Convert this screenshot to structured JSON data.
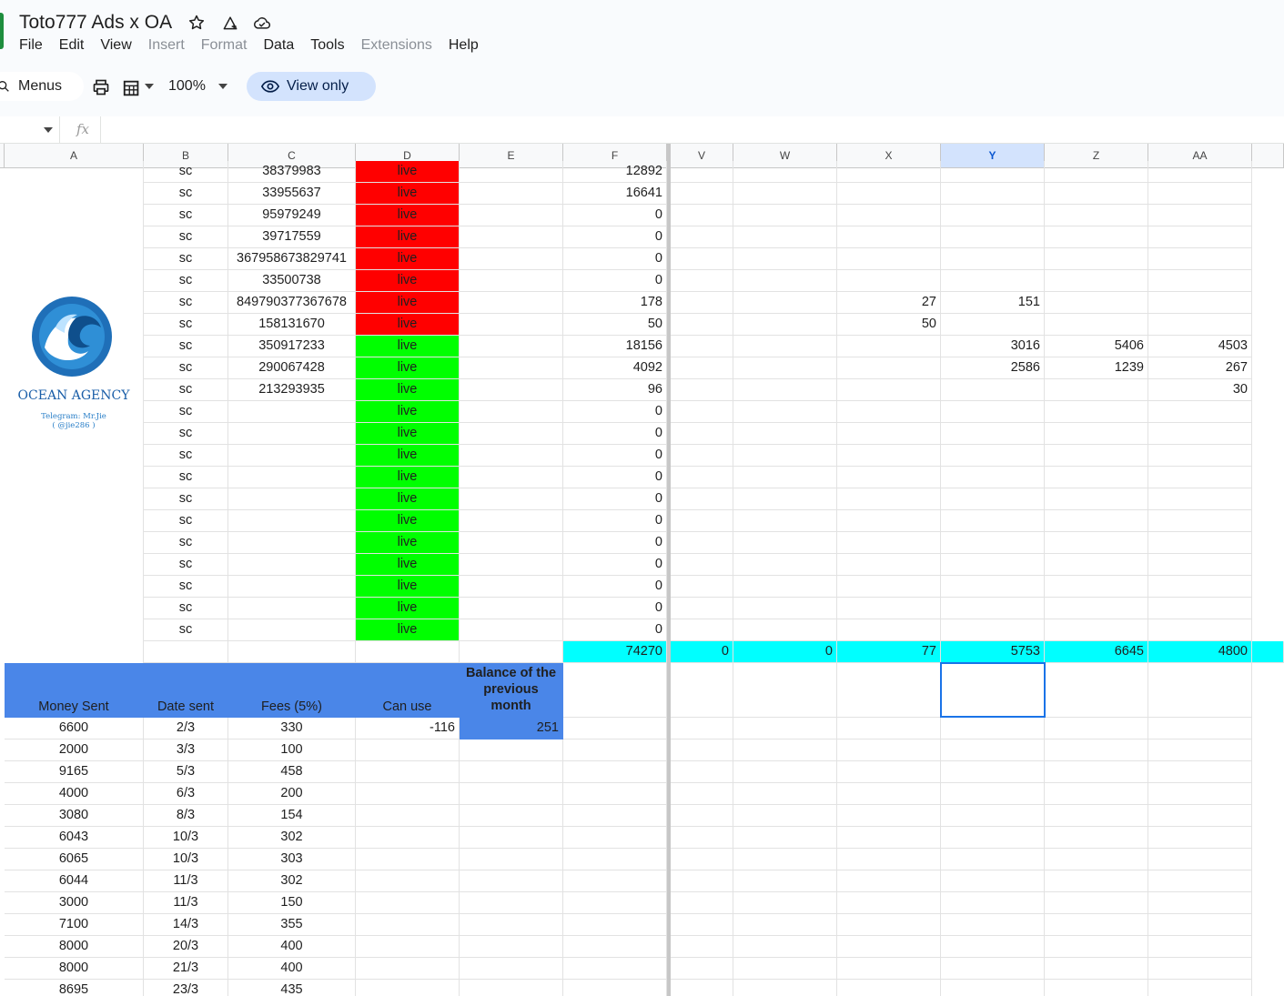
{
  "app": {
    "title": "Toto777 Ads x OA",
    "menu": [
      {
        "label": "File",
        "dim": false
      },
      {
        "label": "Edit",
        "dim": false
      },
      {
        "label": "View",
        "dim": false
      },
      {
        "label": "Insert",
        "dim": true
      },
      {
        "label": "Format",
        "dim": true
      },
      {
        "label": "Data",
        "dim": false
      },
      {
        "label": "Tools",
        "dim": false
      },
      {
        "label": "Extensions",
        "dim": true
      },
      {
        "label": "Help",
        "dim": false
      }
    ],
    "toolbar": {
      "menus_label": "Menus",
      "zoom": "100%",
      "view_only": "View only"
    },
    "formula_bar": {
      "fx": "fx",
      "value": ""
    }
  },
  "colors": {
    "red": "#ff0000",
    "green": "#00ff00",
    "cyan": "#00ffff",
    "blue": "#4a86e8"
  },
  "logo": {
    "name": "OCEAN AGENCY",
    "telegram": "Telegram: Mr.Jie",
    "handle": "( @jie286 )"
  },
  "columns": [
    "A",
    "B",
    "C",
    "D",
    "E",
    "F",
    "V",
    "W",
    "X",
    "Y",
    "Z",
    "AA"
  ],
  "selected_column": "Y",
  "rows": [
    {
      "b": "sc",
      "c": "38379983",
      "d": "live",
      "status": "red",
      "note": false,
      "f": "12892",
      "v": "",
      "w": "",
      "x": "",
      "y": "",
      "z": "",
      "aa": ""
    },
    {
      "b": "sc",
      "c": "33955637",
      "d": "live",
      "status": "red",
      "note": true,
      "f": "16641",
      "v": "",
      "w": "",
      "x": "",
      "y": "",
      "z": "",
      "aa": ""
    },
    {
      "b": "sc",
      "c": "95979249",
      "d": "live",
      "status": "red",
      "note": false,
      "f": "0",
      "v": "",
      "w": "",
      "x": "",
      "y": "",
      "z": "",
      "aa": ""
    },
    {
      "b": "sc",
      "c": "39717559",
      "d": "live",
      "status": "red",
      "note": false,
      "f": "0",
      "v": "",
      "w": "",
      "x": "",
      "y": "",
      "z": "",
      "aa": ""
    },
    {
      "b": "sc",
      "c": "367958673829741",
      "d": "live",
      "status": "red",
      "note": false,
      "f": "0",
      "v": "",
      "w": "",
      "x": "",
      "y": "",
      "z": "",
      "aa": ""
    },
    {
      "b": "sc",
      "c": "33500738",
      "d": "live",
      "status": "red",
      "note": false,
      "f": "0",
      "v": "",
      "w": "",
      "x": "",
      "y": "",
      "z": "",
      "aa": ""
    },
    {
      "b": "sc",
      "c": "849790377367678",
      "d": "live",
      "status": "red",
      "note": false,
      "f": "178",
      "v": "",
      "w": "",
      "x": "27",
      "y": "151",
      "z": "",
      "aa": ""
    },
    {
      "b": "sc",
      "c": "158131670",
      "d": "live",
      "status": "red",
      "note": true,
      "f": "50",
      "v": "",
      "w": "",
      "x": "50",
      "y": "",
      "z": "",
      "aa": ""
    },
    {
      "b": "sc",
      "c": "350917233",
      "d": "live",
      "status": "green",
      "note": false,
      "f": "18156",
      "v": "",
      "w": "",
      "x": "",
      "y": "3016",
      "z": "5406",
      "aa": "4503"
    },
    {
      "b": "sc",
      "c": "290067428",
      "d": "live",
      "status": "green",
      "note": false,
      "f": "4092",
      "v": "",
      "w": "",
      "x": "",
      "y": "2586",
      "z": "1239",
      "aa": "267"
    },
    {
      "b": "sc",
      "c": "213293935",
      "d": "live",
      "status": "green",
      "note": false,
      "f": "96",
      "v": "",
      "w": "",
      "x": "",
      "y": "",
      "z": "",
      "aa": "30"
    },
    {
      "b": "sc",
      "c": "",
      "d": "live",
      "status": "green",
      "note": false,
      "f": "0",
      "v": "",
      "w": "",
      "x": "",
      "y": "",
      "z": "",
      "aa": ""
    },
    {
      "b": "sc",
      "c": "",
      "d": "live",
      "status": "green",
      "note": false,
      "f": "0",
      "v": "",
      "w": "",
      "x": "",
      "y": "",
      "z": "",
      "aa": ""
    },
    {
      "b": "sc",
      "c": "",
      "d": "live",
      "status": "green",
      "note": false,
      "f": "0",
      "v": "",
      "w": "",
      "x": "",
      "y": "",
      "z": "",
      "aa": ""
    },
    {
      "b": "sc",
      "c": "",
      "d": "live",
      "status": "green",
      "note": false,
      "f": "0",
      "v": "",
      "w": "",
      "x": "",
      "y": "",
      "z": "",
      "aa": ""
    },
    {
      "b": "sc",
      "c": "",
      "d": "live",
      "status": "green",
      "note": false,
      "f": "0",
      "v": "",
      "w": "",
      "x": "",
      "y": "",
      "z": "",
      "aa": ""
    },
    {
      "b": "sc",
      "c": "",
      "d": "live",
      "status": "green",
      "note": false,
      "f": "0",
      "v": "",
      "w": "",
      "x": "",
      "y": "",
      "z": "",
      "aa": ""
    },
    {
      "b": "sc",
      "c": "",
      "d": "live",
      "status": "green",
      "note": false,
      "f": "0",
      "v": "",
      "w": "",
      "x": "",
      "y": "",
      "z": "",
      "aa": ""
    },
    {
      "b": "sc",
      "c": "",
      "d": "live",
      "status": "green",
      "note": false,
      "f": "0",
      "v": "",
      "w": "",
      "x": "",
      "y": "",
      "z": "",
      "aa": ""
    },
    {
      "b": "sc",
      "c": "",
      "d": "live",
      "status": "green",
      "note": false,
      "f": "0",
      "v": "",
      "w": "",
      "x": "",
      "y": "",
      "z": "",
      "aa": ""
    },
    {
      "b": "sc",
      "c": "",
      "d": "live",
      "status": "green",
      "note": false,
      "f": "0",
      "v": "",
      "w": "",
      "x": "",
      "y": "",
      "z": "",
      "aa": ""
    },
    {
      "b": "sc",
      "c": "",
      "d": "live",
      "status": "green",
      "note": false,
      "f": "0",
      "v": "",
      "w": "",
      "x": "",
      "y": "",
      "z": "",
      "aa": ""
    }
  ],
  "totals": {
    "f": "74270",
    "v": "0",
    "w": "0",
    "x": "77",
    "y": "5753",
    "z": "6645",
    "aa": "4800"
  },
  "payments_header": {
    "money_sent": "Money Sent",
    "date_sent": "Date sent",
    "fees": "Fees (5%)",
    "can_use": "Can use",
    "balance": "Balance of the previous month"
  },
  "payments": [
    {
      "money": "6600",
      "date": "2/3",
      "fee": "330",
      "can_use": "-116",
      "balance": "251"
    },
    {
      "money": "2000",
      "date": "3/3",
      "fee": "100",
      "can_use": "",
      "balance": ""
    },
    {
      "money": "9165",
      "date": "5/3",
      "fee": "458",
      "can_use": "",
      "balance": ""
    },
    {
      "money": "4000",
      "date": "6/3",
      "fee": "200",
      "can_use": "",
      "balance": ""
    },
    {
      "money": "3080",
      "date": "8/3",
      "fee": "154",
      "can_use": "",
      "balance": ""
    },
    {
      "money": "6043",
      "date": "10/3",
      "fee": "302",
      "can_use": "",
      "balance": ""
    },
    {
      "money": "6065",
      "date": "10/3",
      "fee": "303",
      "can_use": "",
      "balance": ""
    },
    {
      "money": "6044",
      "date": "11/3",
      "fee": "302",
      "can_use": "",
      "balance": ""
    },
    {
      "money": "3000",
      "date": "11/3",
      "fee": "150",
      "can_use": "",
      "balance": ""
    },
    {
      "money": "7100",
      "date": "14/3",
      "fee": "355",
      "can_use": "",
      "balance": ""
    },
    {
      "money": "8000",
      "date": "20/3",
      "fee": "400",
      "can_use": "",
      "balance": ""
    },
    {
      "money": "8000",
      "date": "21/3",
      "fee": "400",
      "can_use": "",
      "balance": ""
    },
    {
      "money": "8695",
      "date": "23/3",
      "fee": "435",
      "can_use": "",
      "balance": ""
    }
  ]
}
